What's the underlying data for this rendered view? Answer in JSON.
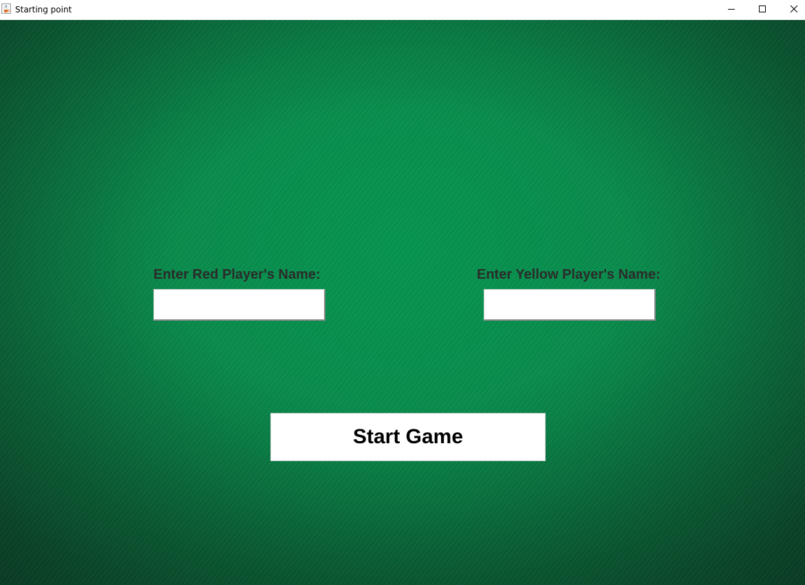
{
  "window": {
    "title": "Starting point",
    "icon": "java-cup-icon",
    "controls": {
      "minimize": "minimize-icon",
      "maximize": "maximize-icon",
      "close": "close-icon"
    }
  },
  "form": {
    "red_label": "Enter Red Player's Name:",
    "red_value": "",
    "yellow_label": "Enter Yellow Player's Name:",
    "yellow_value": "",
    "start_label": "Start Game"
  },
  "colors": {
    "background": "#078a4a",
    "label_text": "#2b2b2b"
  }
}
